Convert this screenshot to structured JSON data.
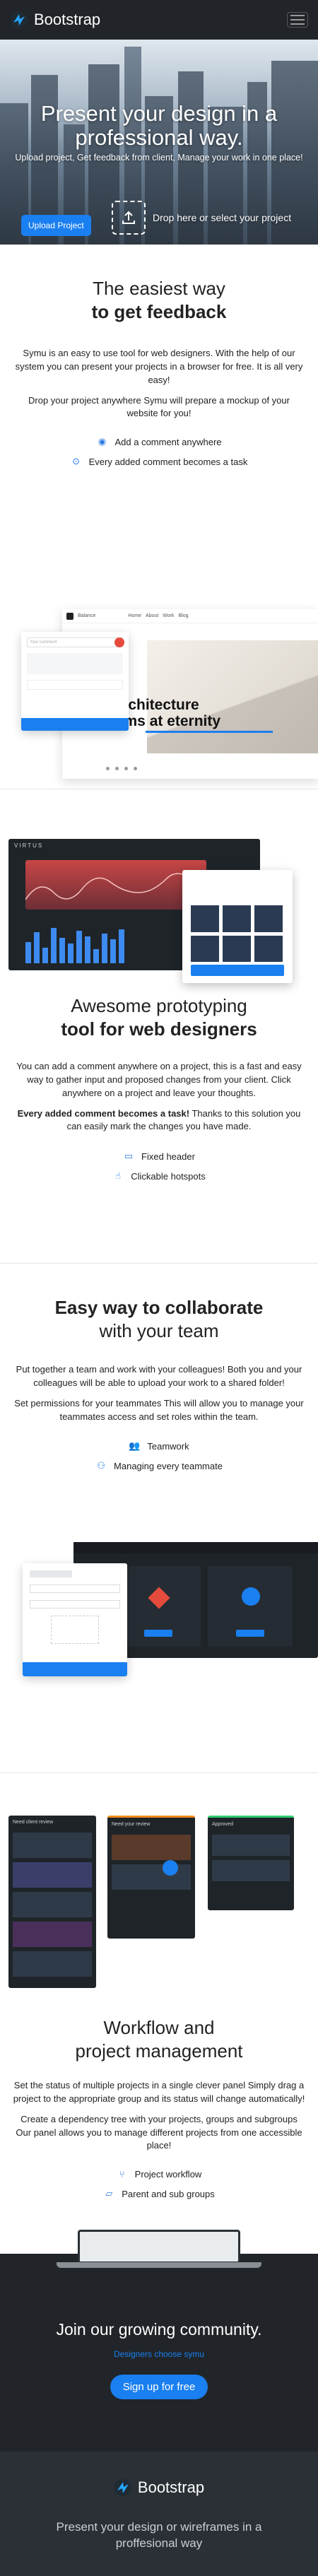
{
  "nav": {
    "brand": "Bootstrap"
  },
  "hero": {
    "title": "Present your design in a professional way.",
    "subtitle": "Upload project, Get feedback from client, Manage your work in one place!",
    "upload_label": "Upload Project",
    "drop_label": "Drop here or select your project"
  },
  "feedback": {
    "heading_top": "The easiest way",
    "heading_bold": "to get feedback",
    "p1": "Symu is an easy to use tool for web designers. With the help of our system you can present your projects in a browser for free. It is all very easy!",
    "p2": "Drop your project anywhere Symu will prepare a mockup of your website for you!",
    "features": [
      "Add a comment anywhere",
      "Every added comment becomes a task"
    ],
    "mock_text": "Architecture\naims at eternity"
  },
  "prototyping": {
    "heading_top": "Awesome prototyping",
    "heading_bold": "tool for web designers",
    "p1": "You can add a comment anywhere on a project, this is a fast and easy way to gather input and proposed changes from your client. Click anywhere on a project and leave your thoughts.",
    "p2_bold": "Every added comment becomes a task!",
    "p2_rest": " Thanks to this solution you can easily mark the changes you have made.",
    "features": [
      "Fixed header",
      "Clickable hotspots"
    ],
    "mock_logo": "VIRTUS"
  },
  "collab": {
    "heading_bold": "Easy way to collaborate",
    "heading_rest": "with your team",
    "p1": "Put together a team and work with your colleagues! Both you and your colleagues will be able to upload your work to a shared folder!",
    "p2": "Set permissions for your teammates This will allow you to manage your teammates access and set roles within the team.",
    "features": [
      "Teamwork",
      "Managing every teammate"
    ]
  },
  "workflow": {
    "heading_top": "Workflow and",
    "heading_bottom": "project management",
    "p1": "Set the status of multiple projects in a single clever panel Simply drag a project to the appropriate group and its status will change automatically!",
    "p2": "Create a dependency tree with your projects, groups and subgroups Our panel allows you to manage different projects from one accessible place!",
    "features": [
      "Project workflow",
      "Parent and sub groups"
    ],
    "columns": [
      "Need client review",
      "Need your review",
      "Approved"
    ]
  },
  "join": {
    "title": "Join our growing community.",
    "subtitle": "Designers choose symu",
    "button": "Sign up for free"
  },
  "footer": {
    "brand": "Bootstrap",
    "tagline": "Present your design or wireframes in a proffesional way"
  },
  "colors": {
    "accent": "#1a7ff0",
    "dark": "#212529",
    "footer": "#2b3036"
  }
}
